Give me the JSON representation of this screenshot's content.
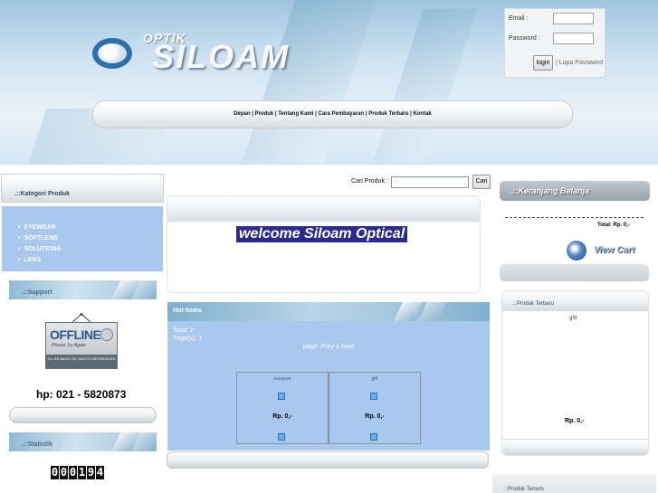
{
  "brand": {
    "prefix": "OPTIK",
    "name": "SILOAM"
  },
  "login": {
    "email_label": "Email :",
    "password_label": "Password :",
    "button_label": "login",
    "forgot_label": "| Lupa Password"
  },
  "nav": {
    "text": "Depan | Produk | Tentang Kami | Cara Pembayaran | Produk Terbaru | Kontak"
  },
  "sidebar": {
    "kategori_title": ".::Kategori Produk",
    "categories": [
      "EYEWEAR",
      "SOFTLENS",
      "SOLUTIONS",
      "LENS"
    ],
    "support_title": ".::Support",
    "offline": {
      "word": "OFFLINE",
      "subtitle": "Please Try Again",
      "band": "I'LL BE BACK ON YAHOO! MESSENGER"
    },
    "phone": "hp: 021 - 5820873",
    "statistik_title": ".::Statistik",
    "counter_digits": [
      "0",
      "0",
      "0",
      "1",
      "9",
      "4"
    ]
  },
  "search": {
    "label": "Cari Produk :",
    "value": "",
    "button_label": "Cari"
  },
  "main": {
    "welcome": "welcome Siloam Optical",
    "hot_title": "Hot Items",
    "total": "Total: 2",
    "pages": "Page(s): 1",
    "pagination": "page: Prev 1 Next",
    "items": [
      {
        "name": "passport",
        "price": "Rp. 0,-"
      },
      {
        "name": "gfd",
        "price": "Rp. 0,-"
      }
    ]
  },
  "cart": {
    "title": ".::Keranjang Belanja",
    "total": "Total: Rp. 0,-",
    "view_label": "View Cart"
  },
  "produk_terbaru": {
    "title": ".::Produk Terbaru",
    "name": "gfd",
    "price": "Rp. 0,-"
  },
  "produk_terlaris": {
    "title": ".::Produk Terlaris"
  },
  "colors": {
    "panel_blue": "#a9c8ee",
    "welcome_bg": "#2b2b8e"
  }
}
